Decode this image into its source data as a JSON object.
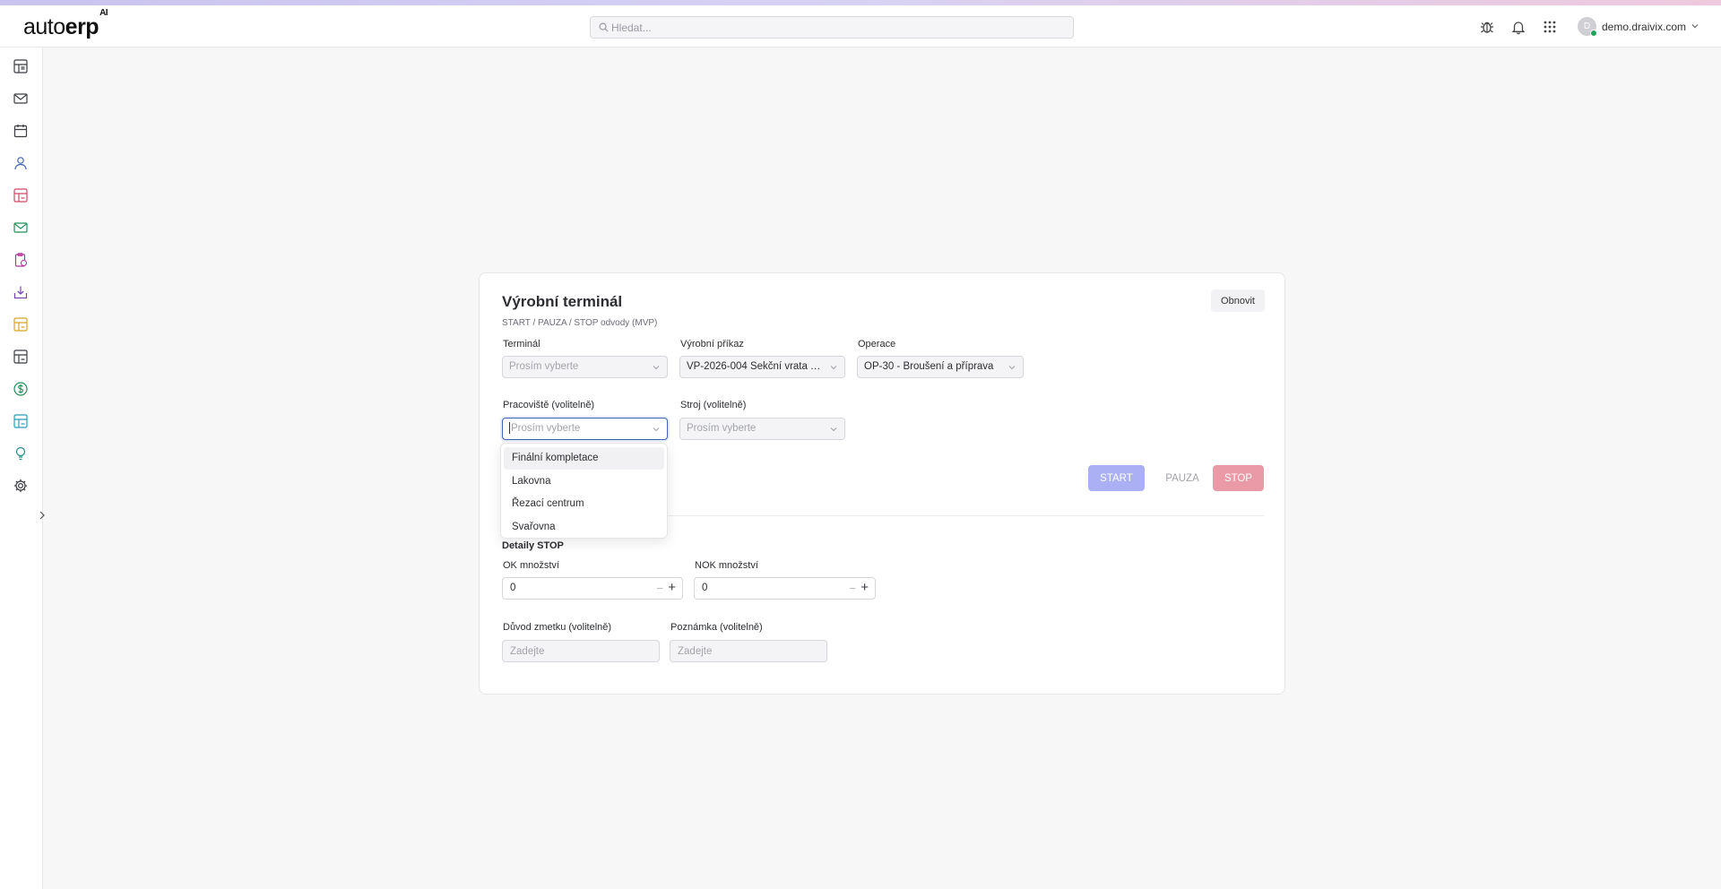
{
  "app": {
    "logo_main": "auto",
    "logo_bold": "erp",
    "logo_sup": "AI"
  },
  "header": {
    "search_placeholder": "Hledat...",
    "user_initial": "D",
    "user_name": "demo.draivix.com"
  },
  "colors": {
    "accent": "#3f63b8",
    "start": "#abb0f4",
    "stop": "#ea9aa6",
    "online": "#22a35a"
  },
  "sidebar": {
    "icons": [
      "dashboard-icon",
      "mail-icon",
      "calendar-icon",
      "person-icon",
      "report-icon",
      "mail-icon",
      "clipboard-icon",
      "inbox-download-icon",
      "chart-icon",
      "table-icon",
      "dollar-icon",
      "analytics-icon",
      "lightbulb-icon",
      "gear-icon"
    ]
  },
  "card": {
    "title": "Výrobní terminál",
    "subtitle": "START / PAUZA / STOP odvody (MVP)",
    "refresh_label": "Obnovit"
  },
  "form": {
    "terminal": {
      "label": "Terminál",
      "value": "Prosím vyberte"
    },
    "order": {
      "label": "Výrobní příkaz",
      "value": "VP-2026-004 Sekční vrata T..."
    },
    "operation": {
      "label": "Operace",
      "value": "OP-30 - Broušení a příprava"
    },
    "workplace": {
      "label": "Pracoviště (volitelně)",
      "value": "Prosím vyberte"
    },
    "machine": {
      "label": "Stroj (volitelně)",
      "value": "Prosím vyberte"
    }
  },
  "actions": {
    "start": "START",
    "pause": "PAUZA",
    "stop": "STOP"
  },
  "stop_details": {
    "title": "Detaily STOP",
    "ok_label": "OK množství",
    "ok_value": "0",
    "nok_label": "NOK množství",
    "nok_value": "0",
    "reason_label": "Důvod zmetku (volitelně)",
    "reason_placeholder": "Zadejte",
    "note_label": "Poznámka (volitelně)",
    "note_placeholder": "Zadejte"
  },
  "dropdown": {
    "options": [
      "Finální kompletace",
      "Lakovna",
      "Řezací centrum",
      "Svařovna"
    ]
  }
}
